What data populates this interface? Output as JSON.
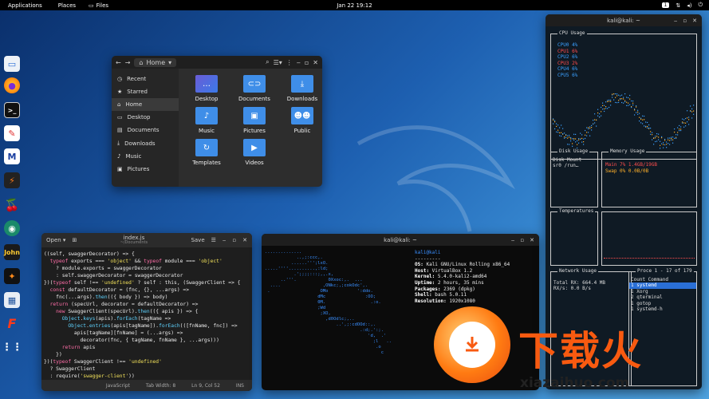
{
  "topbar": {
    "applications": "Applications",
    "places": "Places",
    "files": "Files",
    "clock": "Jan 22  19:12",
    "workspace": "1"
  },
  "dock": [
    "file-manager-icon",
    "firefox-icon",
    "terminal-icon",
    "text-editor-icon",
    "metasploit-icon",
    "burp-icon",
    "cherrytree-icon",
    "maltego-icon",
    "john-icon",
    "kali-dragon-icon",
    "kali-tools-icon",
    "faraday-icon",
    "app-grid-icon"
  ],
  "files_window": {
    "location": "Home",
    "sidebar": [
      "Recent",
      "Starred",
      "Home",
      "Desktop",
      "Documents",
      "Downloads",
      "Music",
      "Pictures"
    ],
    "folders": [
      "Desktop",
      "Documents",
      "Downloads",
      "Music",
      "Pictures",
      "Public",
      "Templates",
      "Videos"
    ]
  },
  "editor": {
    "open_label": "Open",
    "filename": "index.js",
    "path": "~/Documents",
    "save_label": "Save",
    "lines": [
      "((self, swaggerDecorator) => {",
      "  typeof exports === 'object' && typeof module === 'object'",
      "    ? module.exports = swaggerDecorator",
      "    : self.swaggerDecorator = swaggerDecorator",
      "})(typeof self !== 'undefined' ? self : this, (SwaggerClient => {",
      "  const defaultDecorator = (fnc, {}, ...args) =>",
      "    fnc(...args).then(({ body }) => body)",
      "  return (specUrl, decorator = defaultDecorator) =>",
      "    new SwaggerClient(specUrl).then(({ apis }) => {",
      "      Object.keys(apis).forEach(tagName =>",
      "        Object.entries(apis[tagName]).forEach(([fnName, fnc]) =>",
      "          apis[tagName][fnName] = (...args) =>",
      "            decorator(fnc, { tagName, fnName }, ...args)))",
      "      return apis",
      "    })",
      "})(typeof SwaggerClient !== 'undefined'",
      "  ? SwaggerClient",
      "  : require('swagger-client'))"
    ],
    "status_lang": "JavaScript",
    "status_tab": "Tab Width: 8",
    "status_pos": "Ln 9, Col 52",
    "status_mode": "INS"
  },
  "terminal": {
    "title": "kali@kali: ~",
    "user": "kali@kali",
    "sep": "---------",
    "info": [
      [
        "OS:",
        " Kali GNU/Linux Rolling x86_64"
      ],
      [
        "Host:",
        " VirtualBox 1.2"
      ],
      [
        "Kernel:",
        " 5.4.0-kali2-amd64"
      ],
      [
        "Uptime:",
        " 2 hours, 35 mins"
      ],
      [
        "Packages:",
        " 2369 (dpkg)"
      ],
      [
        "Shell:",
        " bash 5.0.11"
      ],
      [
        "Resolution:",
        " 1920x1080"
      ]
    ]
  },
  "htop": {
    "title": "kali@kali: ~",
    "cpu_title": "CPU Usage",
    "cpus": [
      {
        "name": "CPU0",
        "val": "4%",
        "color": "#3aa0ff"
      },
      {
        "name": "CPU1",
        "val": "6%",
        "color": "#ff4d4d"
      },
      {
        "name": "CPU2",
        "val": "6%",
        "color": "#3aa0ff"
      },
      {
        "name": "CPU3",
        "val": "2%",
        "color": "#ff4d4d"
      },
      {
        "name": "CPU4",
        "val": "6%",
        "color": "#3aa0ff"
      },
      {
        "name": "CPU5",
        "val": "6%",
        "color": "#3aa0ff"
      }
    ],
    "disk_title": "Disk Usage",
    "disk_head": "Disk  Mount",
    "disk_row": "sr0   /run…",
    "mem_title": "Memory Usage",
    "mem_main": "Main    7%   1.4GB/19GB",
    "mem_swap": "Swap    0%   0.0B/0B",
    "temp_title": "Temperatures",
    "net_title": "Network Usage",
    "net_rx": "Total RX: 664.4 MB",
    "net_rxs": "RX/s:        0.0  B/s",
    "proc_title": "Proce 1 - 17 of 179",
    "proc_head": "Count   Command",
    "procs": [
      "1       systemd",
      "1       Xorg",
      "2       qterminal",
      "1       gotop",
      "1       systemd-h"
    ]
  },
  "promo": {
    "text": "下载火",
    "url": "xiazaihuo.com"
  }
}
